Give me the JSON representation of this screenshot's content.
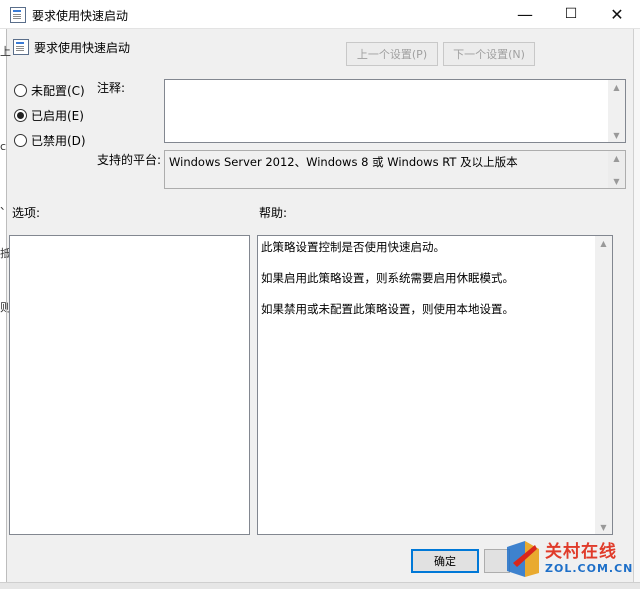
{
  "window": {
    "title": "要求使用快速启动",
    "controls": {
      "minimize": "—",
      "maximize": "☐",
      "close": "✕"
    }
  },
  "header": {
    "policy_name": "要求使用快速启动",
    "prev_label": "上一个设置(P)",
    "next_label": "下一个设置(N)"
  },
  "state": {
    "options": [
      {
        "label": "未配置(C)",
        "checked": false
      },
      {
        "label": "已启用(E)",
        "checked": true
      },
      {
        "label": "已禁用(D)",
        "checked": false
      }
    ]
  },
  "comment": {
    "label": "注释:",
    "value": ""
  },
  "supported": {
    "label": "支持的平台:",
    "value": "Windows Server 2012、Windows 8 或 Windows RT 及以上版本"
  },
  "options_panel": {
    "label": "选项:"
  },
  "help_panel": {
    "label": "帮助:",
    "paragraphs": [
      "此策略设置控制是否使用快速启动。",
      "如果启用此策略设置，则系统需要启用休眠模式。",
      "如果禁用或未配置此策略设置，则使用本地设置。"
    ]
  },
  "footer": {
    "ok_label": "确定"
  },
  "background_fragments": [
    "上",
    "c",
    "、",
    "抵",
    "则"
  ],
  "watermark": {
    "name": "关村在线",
    "domain": "ZOL.COM.CN"
  },
  "colors": {
    "focus_border": "#0078d7",
    "window_bg": "#f0f0f0"
  }
}
